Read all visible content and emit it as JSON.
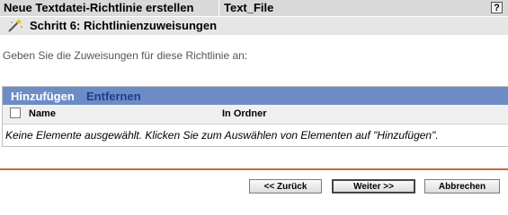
{
  "header": {
    "title": "Neue Textdatei-Richtlinie erstellen",
    "policy_type": "Text_File",
    "help_label": "?"
  },
  "step": {
    "icon": "wizard-wand-icon",
    "title": "Schritt 6: Richtlinienzuweisungen"
  },
  "intro_text": "Geben Sie die Zuweisungen für diese Richtlinie an:",
  "list": {
    "toolbar": {
      "add_label": "Hinzufügen",
      "remove_label": "Entfernen"
    },
    "columns": [
      "Name",
      "In Ordner"
    ],
    "empty_message": "Keine Elemente ausgewählt. Klicken Sie zum Auswählen von Elementen auf \"Hinzufügen\"."
  },
  "buttons": {
    "back": "<< Zurück",
    "next": "Weiter >>",
    "cancel": "Abbrechen"
  },
  "colors": {
    "toolbar_bg": "#6d8cc6",
    "divider": "#c86a3a"
  }
}
